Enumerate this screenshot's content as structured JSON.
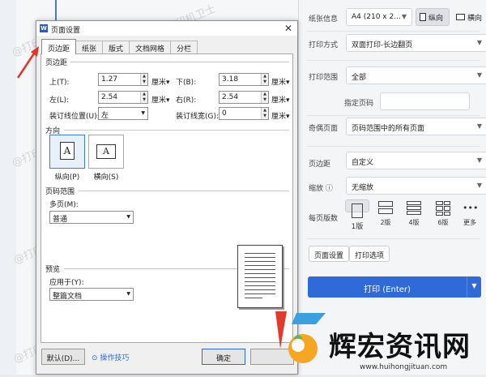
{
  "watermark": "@打印机卫士",
  "dialog": {
    "title": "页面设置",
    "tabs": [
      "页边距",
      "纸张",
      "版式",
      "文档网格",
      "分栏"
    ],
    "margins_group": "页边距",
    "top_label": "上(T):",
    "top_value": "1.27",
    "bottom_label": "下(B):",
    "bottom_value": "3.18",
    "left_label": "左(L):",
    "left_value": "2.54",
    "right_label": "右(R):",
    "right_value": "2.54",
    "gutter_pos_label": "装订线位置(U):",
    "gutter_pos_value": "左",
    "gutter_label": "装订线宽(G):",
    "gutter_value": "0",
    "unit": "厘米",
    "orientation_group": "方向",
    "portrait_label": "纵向(P)",
    "landscape_label": "横向(S)",
    "pages_group": "页码范围",
    "multi_pages_label": "多页(M):",
    "multi_pages_value": "普通",
    "preview_group": "预览",
    "apply_label": "应用于(Y):",
    "apply_value": "整篇文档",
    "default_button": "默认(D)...",
    "tips_label": "操作技巧",
    "ok_button": "确定"
  },
  "print_panel": {
    "paper_label": "纸张信息",
    "paper_value": "A4 (210 x 2...",
    "portrait": "纵向",
    "landscape": "横向",
    "method_label": "打印方式",
    "method_value": "双面打印-长边翻页",
    "range_label": "打印范围",
    "range_value": "全部",
    "pages_label": "指定页码",
    "oddeven_label": "奇偶页面",
    "oddeven_value": "页码范围中的所有页面",
    "margin_label": "页边距",
    "margin_value": "自定义",
    "scale_label": "缩放",
    "scale_value": "无缩放",
    "per_sheet_label": "每页版数",
    "per_sheet_options": [
      "1版",
      "2版",
      "4版",
      "6版",
      "更多"
    ],
    "page_setup_button": "页面设置",
    "print_options_button": "打印选项",
    "print_button": "打印 (Enter)"
  },
  "logo": {
    "brand": "辉宏资讯网",
    "url": "www.huihongjituan.com"
  }
}
